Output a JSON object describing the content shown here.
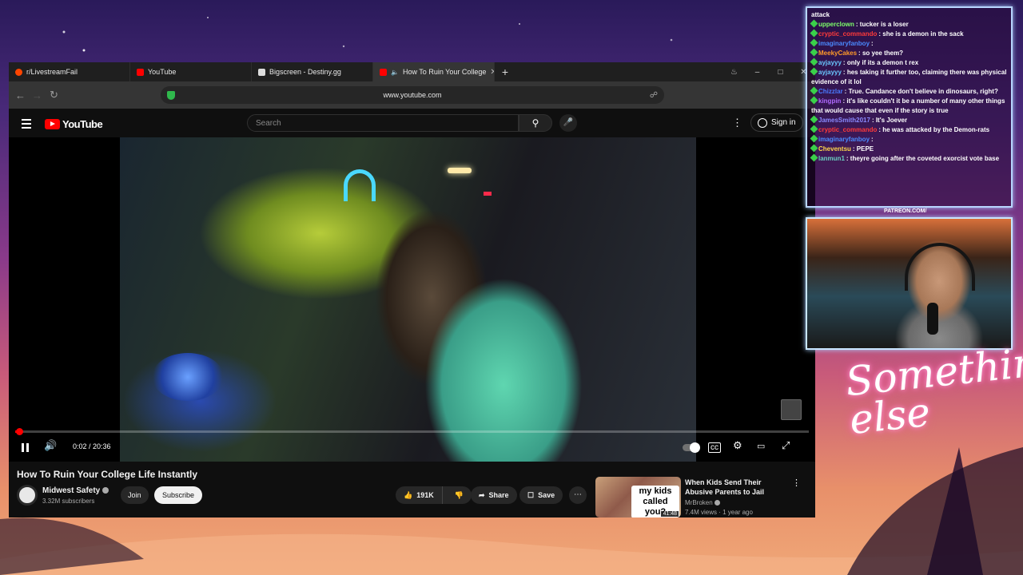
{
  "browser": {
    "tabs": [
      {
        "label": "r/LivestreamFail",
        "color": "#ff4500",
        "active": false
      },
      {
        "label": "YouTube",
        "color": "#ff0000",
        "active": false
      },
      {
        "label": "Bigscreen - Destiny.gg",
        "color": "#dddddd",
        "active": false
      },
      {
        "label": "How To Ruin Your College",
        "color": "#ff0000",
        "active": true
      }
    ],
    "new_tab": "+",
    "url": "www.youtube.com"
  },
  "youtube": {
    "logo": "YouTube",
    "search_placeholder": "Search",
    "sign_in": "Sign in",
    "player": {
      "time": "0:02 / 20:36",
      "progress_fraction": 0.002
    },
    "video": {
      "title": "How To Ruin Your College Life Instantly",
      "channel": "Midwest Safety",
      "subscribers": "3.32M subscribers",
      "join": "Join",
      "subscribe": "Subscribe",
      "likes": "191K",
      "share": "Share",
      "save": "Save"
    },
    "recommended": {
      "thumb_caption": "my kids called you?",
      "duration": "41:48",
      "title": "When Kids Send Their Abusive Parents to Jail",
      "channel": "MrBroken",
      "meta": "7.4M views · 1 year ago"
    }
  },
  "stream": {
    "chat": [
      {
        "user": "",
        "text": "attack",
        "color": "#ffffff",
        "badge": false
      },
      {
        "user": "upperclown",
        "text": "tucker is a loser",
        "color": "#7dff6a",
        "badge": true
      },
      {
        "user": "cryptic_commando",
        "text": "she is a demon in the sack",
        "color": "#ff3a3a",
        "badge": true
      },
      {
        "user": "imaginaryfanboy",
        "text": "",
        "color": "#4a8aff",
        "badge": true
      },
      {
        "user": "MeekyCakes",
        "text": "so yee them?",
        "color": "#ff9a2a",
        "badge": true
      },
      {
        "user": "ayjayyy",
        "text": "only if its a demon t rex",
        "color": "#6ac8ff",
        "badge": true
      },
      {
        "user": "ayjayyy",
        "text": "hes taking it further too, claiming there was physical evidence of it lol",
        "color": "#6ac8ff",
        "badge": true
      },
      {
        "user": "Chizzlar",
        "text": "True. Candance don't believe in dinosaurs, right?",
        "color": "#4a7aff",
        "badge": true
      },
      {
        "user": "kingpin",
        "text": "it's like couldn't it be a number of many other things that would cause that even if the story is true",
        "color": "#b06aff",
        "badge": true
      },
      {
        "user": "JamesSmith2017",
        "text": "It's Joever",
        "color": "#8a8aff",
        "badge": true
      },
      {
        "user": "cryptic_commando",
        "text": "he was attacked by the Demon-rats",
        "color": "#ff3a3a",
        "badge": true
      },
      {
        "user": "imaginaryfanboy",
        "text": "",
        "color": "#4a8aff",
        "badge": true
      },
      {
        "user": "Cheventsu",
        "text": "PEPE",
        "color": "#ffd84a",
        "badge": true
      },
      {
        "user": "lanmun1",
        "text": "theyre going after the coveted exorcist vote base",
        "color": "#6ad0c0",
        "badge": true
      }
    ],
    "patreon": "PATREON.COM/",
    "signature": "Something else"
  }
}
